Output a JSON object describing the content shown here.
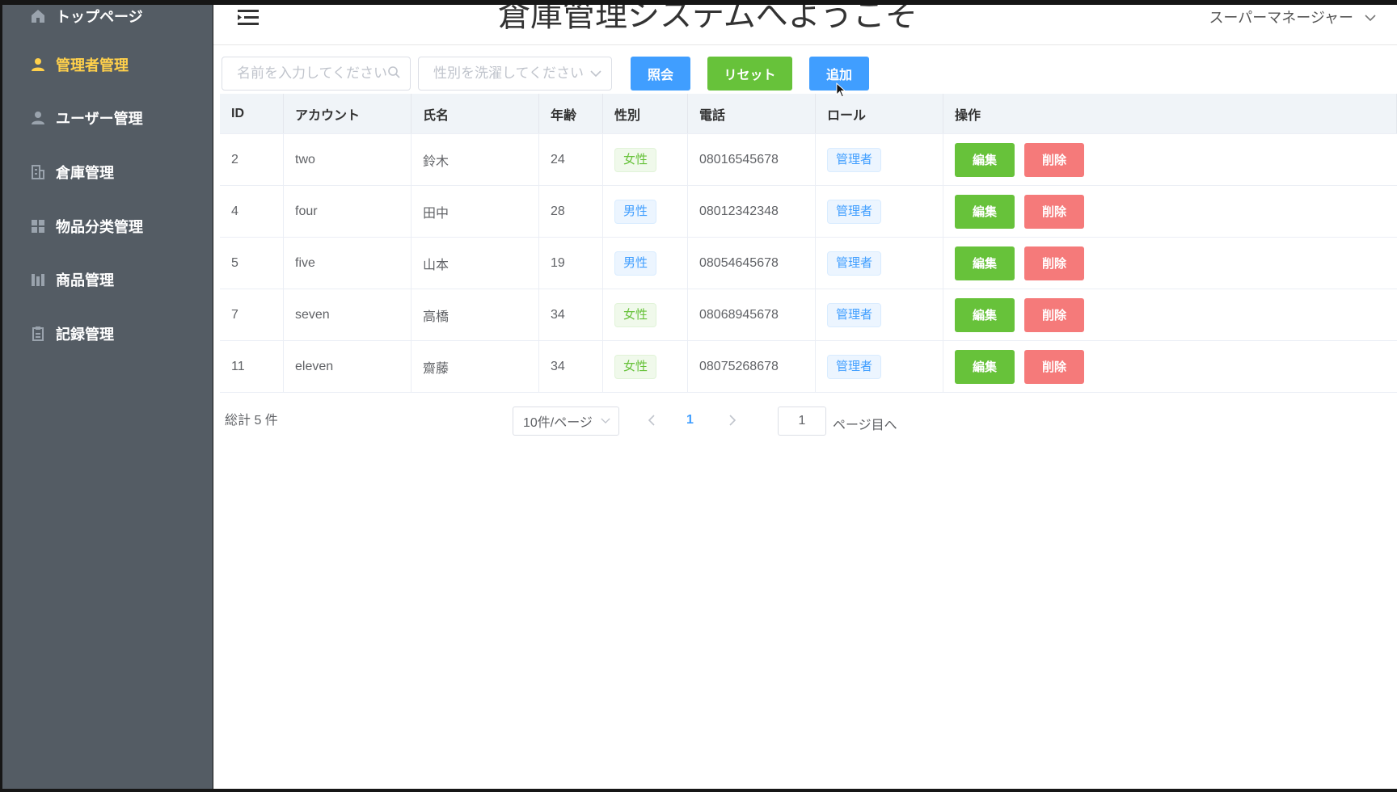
{
  "sidebar": {
    "items": [
      {
        "label": "トップページ",
        "icon": "home-icon"
      },
      {
        "label": "管理者管理",
        "icon": "user-icon",
        "active": true
      },
      {
        "label": "ユーザー管理",
        "icon": "user-icon"
      },
      {
        "label": "倉庫管理",
        "icon": "building-icon"
      },
      {
        "label": "物品分类管理",
        "icon": "grid-icon"
      },
      {
        "label": "商品管理",
        "icon": "bar-chart-icon"
      },
      {
        "label": "記録管理",
        "icon": "document-icon"
      }
    ]
  },
  "header": {
    "title": "倉庫管理システムへようこそ",
    "user": "スーパーマネージャー"
  },
  "toolbar": {
    "name_placeholder": "名前を入力してください",
    "gender_placeholder": "性別を洗濯してください",
    "search_label": "照会",
    "reset_label": "リセット",
    "add_label": "追加"
  },
  "table": {
    "columns": [
      "ID",
      "アカウント",
      "氏名",
      "年齢",
      "性別",
      "電話",
      "ロール",
      "操作"
    ],
    "rows": [
      {
        "id": "2",
        "account": "two",
        "name": "鈴木",
        "age": "24",
        "gender": "女性",
        "phone": "08016545678",
        "role": "管理者"
      },
      {
        "id": "4",
        "account": "four",
        "name": "田中",
        "age": "28",
        "gender": "男性",
        "phone": "08012342348",
        "role": "管理者"
      },
      {
        "id": "5",
        "account": "five",
        "name": "山本",
        "age": "19",
        "gender": "男性",
        "phone": "08054645678",
        "role": "管理者"
      },
      {
        "id": "7",
        "account": "seven",
        "name": "高橋",
        "age": "34",
        "gender": "女性",
        "phone": "08068945678",
        "role": "管理者"
      },
      {
        "id": "11",
        "account": "eleven",
        "name": "齋藤",
        "age": "34",
        "gender": "女性",
        "phone": "08075268678",
        "role": "管理者"
      }
    ],
    "edit_label": "編集",
    "delete_label": "削除"
  },
  "pagination": {
    "total": "総計 5 件",
    "page_size": "10件/ページ",
    "current_page": "1",
    "jump_value": "1",
    "jump_label": "ページ目へ"
  },
  "colors": {
    "sidebar_bg": "#545c64",
    "active": "#ffd04b",
    "primary": "#409eff",
    "success": "#67c23a",
    "danger": "#f56c6c"
  }
}
